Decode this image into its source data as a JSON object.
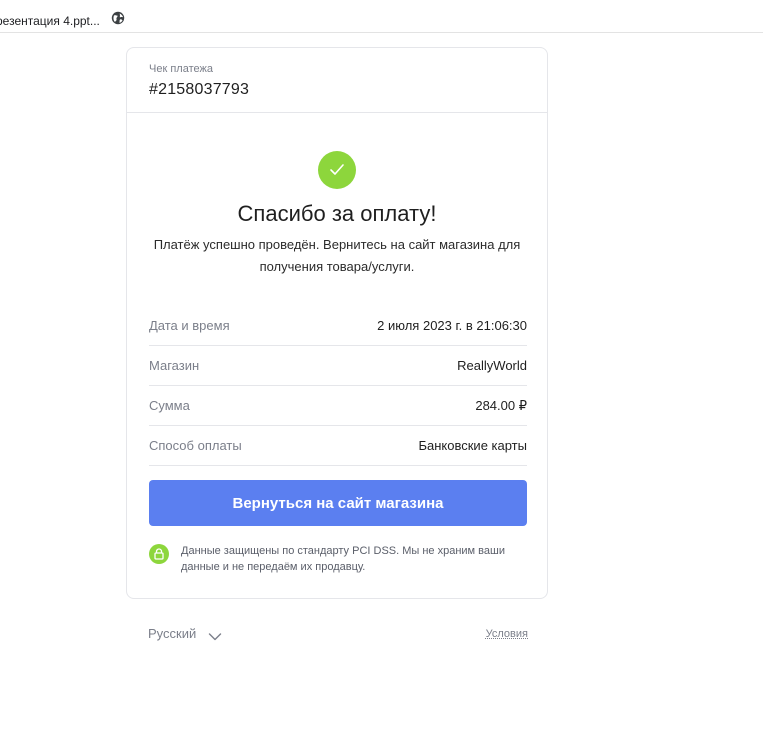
{
  "browser": {
    "tab_title": "резентация 4.ppt...",
    "tab_icon": "globe-icon"
  },
  "receipt": {
    "label": "Чек платежа",
    "number": "#2158037793"
  },
  "status": {
    "icon": "check-icon",
    "color": "#8dd63c",
    "title": "Спасибо за оплату!",
    "subtitle": "Платёж успешно проведён. Вернитесь на сайт магазина для получения товара/услуги."
  },
  "details": [
    {
      "label": "Дата и время",
      "value": "2 июля 2023 г. в 21:06:30"
    },
    {
      "label": "Магазин",
      "value": "ReallyWorld"
    },
    {
      "label": "Сумма",
      "value": "284.00 ₽"
    },
    {
      "label": "Способ оплаты",
      "value": "Банковские карты"
    }
  ],
  "actions": {
    "return_label": "Вернуться на сайт магазина",
    "button_color": "#5b7ff0"
  },
  "security": {
    "icon": "lock-icon",
    "text": "Данные защищены по стандарту PCI DSS. Мы не храним ваши данные и не передаём их продавцу."
  },
  "footer": {
    "language": "Русский",
    "terms_label": "Условия"
  }
}
